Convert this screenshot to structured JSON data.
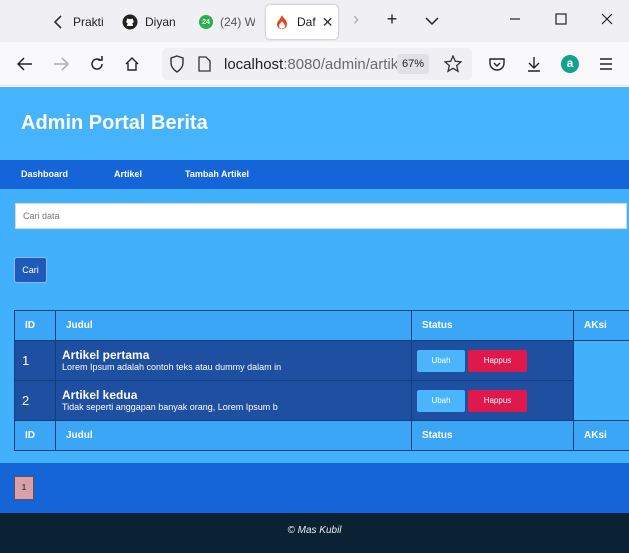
{
  "browser": {
    "tabs": [
      {
        "title": "Prakti",
        "icon": "back-chevron-icon"
      },
      {
        "title": "Diyan",
        "icon": "github-icon"
      },
      {
        "title": "(24) W",
        "icon": "whatsapp-badge-icon",
        "badge": "24"
      },
      {
        "title": "Daf",
        "icon": "flame-icon"
      }
    ],
    "url_host": "localhost",
    "url_path": ":8080/admin/artik",
    "zoom": "67%",
    "profile_initial": "a"
  },
  "site": {
    "title": "Admin Portal Berita",
    "menu": [
      "Dashboard",
      "Artikel",
      "Tambah Artikel"
    ]
  },
  "search": {
    "placeholder": "Cari data",
    "button_label": "Cari"
  },
  "table": {
    "headers": [
      "ID",
      "Judul",
      "Status",
      "AKsi"
    ],
    "rows": [
      {
        "id": "1",
        "title": "Artikel pertama",
        "excerpt": "Lorem Ipsum adalah contoh teks atau dummy dalam in",
        "edit_label": "Ubah",
        "delete_label": "Happus"
      },
      {
        "id": "2",
        "title": "Artikel kedua",
        "excerpt": "Tidak seperti anggapan banyak orang, Lorem Ipsum b",
        "edit_label": "Ubah",
        "delete_label": "Happus"
      }
    ]
  },
  "pagination": {
    "current": "1"
  },
  "footer": {
    "text": "© Mas Kubil"
  },
  "colors": {
    "header_bg": "#45b4fd",
    "menu_bg": "#1565d8",
    "row_bg": "#1f4fa0",
    "delete_btn": "#e0194c",
    "edit_btn": "#4ab4fc",
    "footer_bg": "#0a2233"
  }
}
